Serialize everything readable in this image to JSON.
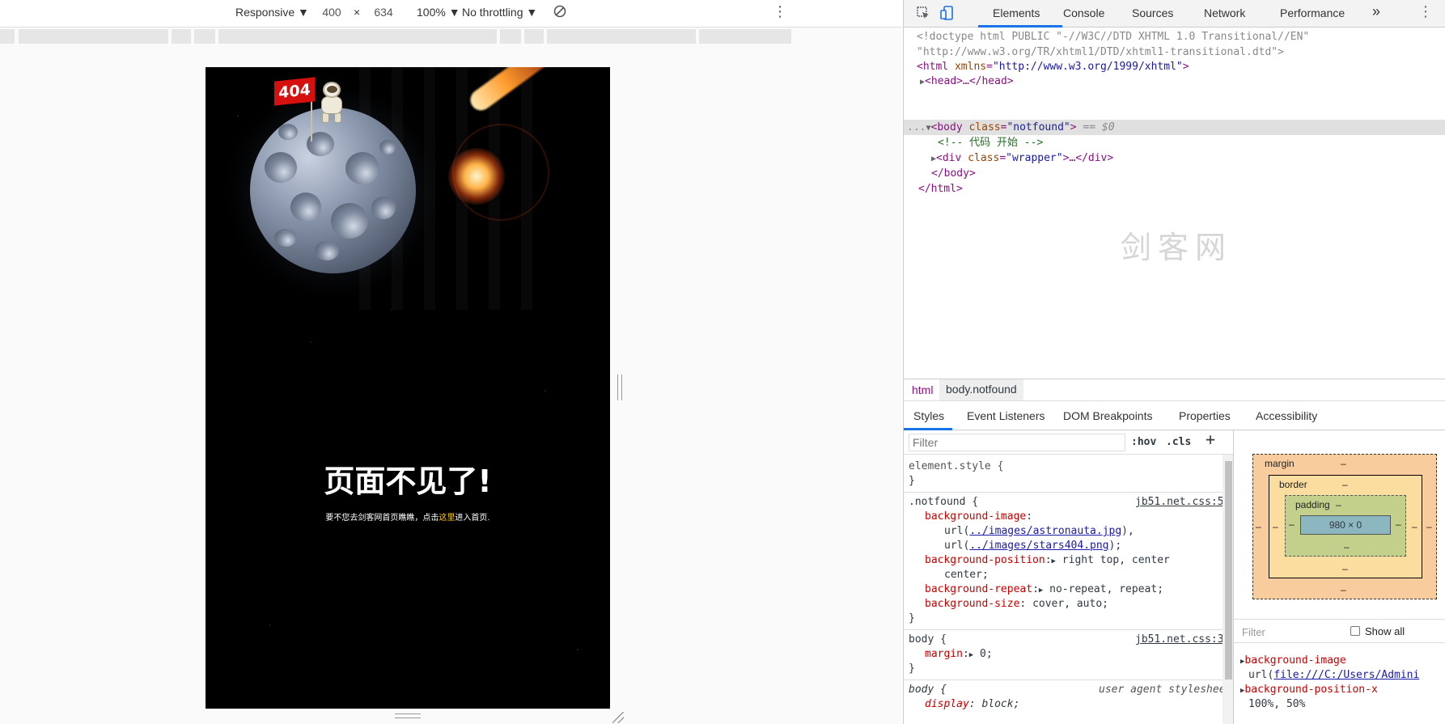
{
  "device_toolbar": {
    "device": "Responsive",
    "width": "400",
    "times": "×",
    "height": "634",
    "zoom": "100%",
    "throttle": "No throttling"
  },
  "page": {
    "flag_text": "404",
    "headline": "页面不见了!",
    "sub_prefix": "要不您去剑客网首页瞧瞧，点击",
    "sub_link": "这里",
    "sub_suffix": "进入首页."
  },
  "devtools": {
    "tabs": [
      "Elements",
      "Console",
      "Sources",
      "Network",
      "Performance"
    ],
    "more": "»",
    "tree": {
      "doctype_1": "<!doctype html PUBLIC \"-//W3C//DTD XHTML 1.0 Transitional//EN\"",
      "doctype_2": "\"http://www.w3.org/TR/xhtml1/DTD/xhtml1-transitional.dtd\">",
      "html_open_tag": "<html",
      "html_attr": "xmlns",
      "html_val": "\"http://www.w3.org/1999/xhtml\"",
      "html_close_bracket": ">",
      "head": "<head>…</head>",
      "dots": "...",
      "body_open_tag": "<body",
      "body_attr": "class",
      "body_val": "\"notfound\"",
      "body_gt": ">",
      "body_eq": "== $0",
      "comment": "<!-- 代码 开始 -->",
      "div_open_tag": "<div",
      "div_attr": "class",
      "div_val": "\"wrapper\"",
      "div_rest": ">…</div>",
      "body_close": "</body>",
      "html_close": "</html>"
    },
    "breadcrumbs": [
      "html",
      "body.notfound"
    ],
    "subtabs": [
      "Styles",
      "Event Listeners",
      "DOM Breakpoints",
      "Properties",
      "Accessibility"
    ],
    "styles": {
      "filter_placeholder": "Filter",
      "hov": ":hov",
      "cls": ".cls",
      "plus": "+",
      "element_style": "element.style {",
      "close_brace": "}",
      "notfound_selector": ".notfound {",
      "notfound_source": "jb51.net.css:5",
      "bg_image_prop": "background-image",
      "bg_image_url1_pre": "url(",
      "bg_image_url1": "../images/astronauta.jpg",
      "bg_image_url1_post": "),",
      "bg_image_url2_pre": "url(",
      "bg_image_url2": "../images/stars404.png",
      "bg_image_url2_post": ");",
      "bg_pos_prop": "background-position",
      "bg_pos_val1": "right top, center",
      "bg_pos_val2": "center;",
      "bg_rep_prop": "background-repeat",
      "bg_rep_val": "no-repeat, repeat;",
      "bg_size_prop": "background-size",
      "bg_size_val": "cover, auto;",
      "body_selector": "body {",
      "body_source": "jb51.net.css:3",
      "margin_prop": "margin",
      "margin_val": "0;",
      "ua_selector": "body {",
      "ua_source": "user agent stylesheet",
      "display_prop": "display",
      "display_val": "block;"
    },
    "boxmodel": {
      "margin_label": "margin",
      "border_label": "border",
      "padding_label": "padding",
      "dash": "–",
      "content": "980 × 0"
    },
    "computed": {
      "filter_placeholder": "Filter",
      "show_all": "Show all",
      "bg_image_prop": "background-image",
      "bg_image_val_pre": "url(",
      "bg_image_val": "file:///C:/Users/Admini",
      "bg_pos_x_prop": "background-position-x",
      "bg_pos_x_val": "100%, 50%"
    },
    "watermark": "剑客网"
  }
}
